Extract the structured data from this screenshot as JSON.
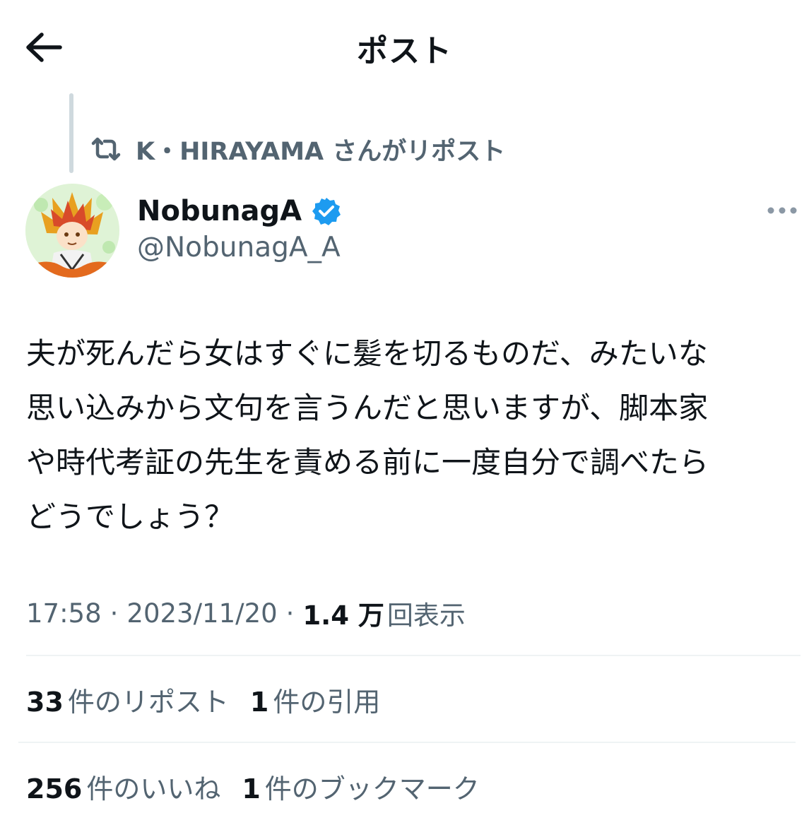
{
  "header": {
    "title": "ポスト",
    "back_icon": "arrow-left-icon"
  },
  "repost_context": {
    "icon": "repost-icon",
    "text": "K・HIRAYAMA さんがリポスト"
  },
  "author": {
    "name": "NobunagA",
    "handle": "@NobunagA_A",
    "verified": true,
    "verified_color": "#1d9bf0"
  },
  "tweet": {
    "lines": [
      "夫が死んだら女はすぐに髪を切るものだ、みたいな",
      "思い込みから文句を言うんだと思いますが、脚本家",
      "や時代考証の先生を責める前に一度自分で調べたら",
      "どうでしょう？"
    ]
  },
  "meta": {
    "time": "17:58",
    "date": "2023/11/20",
    "separator": "·",
    "views_count": "1.4 万",
    "views_label": "回表示"
  },
  "stats": {
    "reposts_count": "33",
    "reposts_label": "件のリポスト",
    "quotes_count": "1",
    "quotes_label": "件の引用",
    "likes_count": "256",
    "likes_label": "件のいいね",
    "bookmarks_count": "1",
    "bookmarks_label": "件のブックマーク"
  },
  "colors": {
    "text_primary": "#0f1419",
    "text_secondary": "#536471",
    "accent": "#1d9bf0",
    "divider": "#eff3f4"
  }
}
